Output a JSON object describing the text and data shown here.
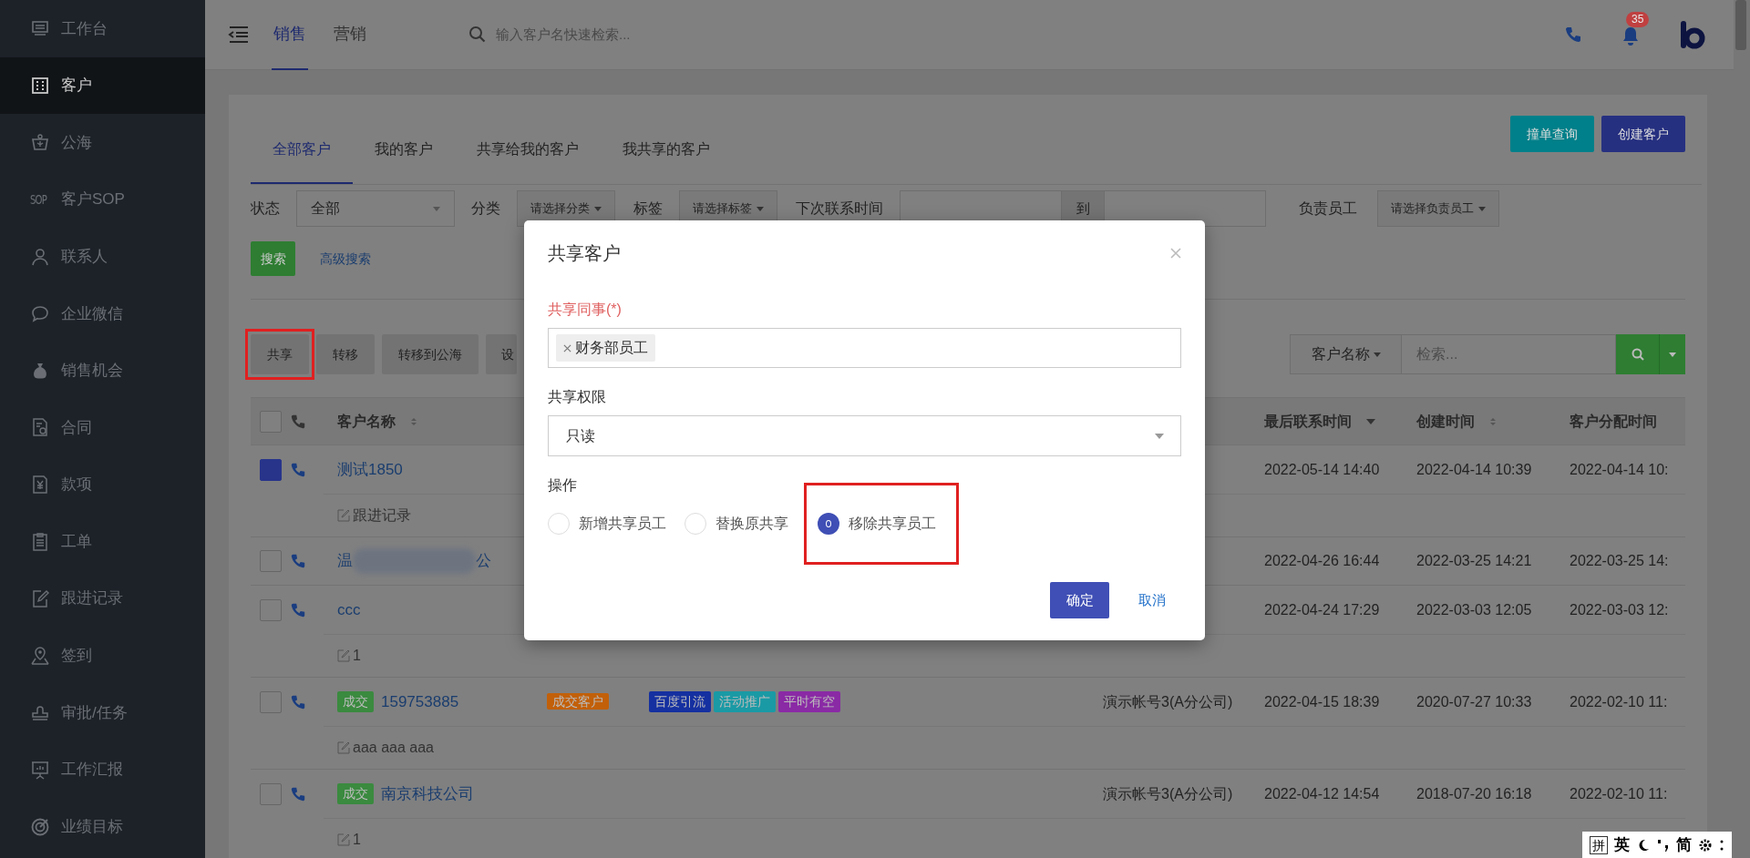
{
  "sidebar": {
    "items": [
      {
        "label": "工作台",
        "selected": false
      },
      {
        "label": "客户",
        "selected": true
      },
      {
        "label": "公海",
        "selected": false
      },
      {
        "label": "客户SOP",
        "icon_text": "SOP",
        "selected": false
      },
      {
        "label": "联系人",
        "selected": false
      },
      {
        "label": "企业微信",
        "selected": false
      },
      {
        "label": "销售机会",
        "selected": false
      },
      {
        "label": "合同",
        "selected": false
      },
      {
        "label": "款项",
        "selected": false
      },
      {
        "label": "工单",
        "selected": false
      },
      {
        "label": "跟进记录",
        "selected": false
      },
      {
        "label": "签到",
        "selected": false
      },
      {
        "label": "审批/任务",
        "selected": false
      },
      {
        "label": "工作汇报",
        "selected": false
      },
      {
        "label": "业绩目标",
        "selected": false
      }
    ]
  },
  "header": {
    "tabs": [
      {
        "label": "销售",
        "selected": true
      },
      {
        "label": "营销",
        "selected": false
      }
    ],
    "search": {
      "placeholder": "输入客户名快速检索..."
    },
    "notification_count": "35"
  },
  "customer_tabs": [
    {
      "label": "全部客户",
      "selected": true
    },
    {
      "label": "我的客户",
      "selected": false
    },
    {
      "label": "共享给我的客户",
      "selected": false
    },
    {
      "label": "我共享的客户",
      "selected": false
    }
  ],
  "top_buttons": [
    {
      "label": "撞单查询",
      "kind": "info"
    },
    {
      "label": "创建客户",
      "kind": "primary"
    }
  ],
  "filters": [
    {
      "kind": "select",
      "label": "状态",
      "value": "全部"
    },
    {
      "kind": "dropdown",
      "label": "分类",
      "placeholder": "请选择分类"
    },
    {
      "kind": "dropdown",
      "label": "标签",
      "placeholder": "请选择标签"
    },
    {
      "kind": "daterange",
      "label": "下次联系时间",
      "separator": "到"
    },
    {
      "kind": "dropdown",
      "label": "负责员工",
      "placeholder": "请选择负责员工"
    }
  ],
  "search_button": "搜索",
  "advanced_search": "高级搜索",
  "actions": [
    {
      "label": "共享",
      "highlighted": true
    },
    {
      "label": "转移",
      "highlighted": false
    },
    {
      "label": "转移到公海",
      "highlighted": false
    },
    {
      "label": "设",
      "highlighted": false
    }
  ],
  "quick_search": {
    "field": "客户名称",
    "placeholder": "检索..."
  },
  "table": {
    "all_checked": false,
    "columns": [
      {
        "label": "客户名称",
        "sortable": true,
        "sorted_desc": false
      },
      {
        "label": "最后联系时间",
        "sortable": true,
        "sorted_desc": true
      },
      {
        "label": "创建时间",
        "sortable": true,
        "sorted_desc": false
      },
      {
        "label": "客户分配时间"
      }
    ],
    "rows": [
      {
        "checked": true,
        "name": "测试1850",
        "last_contact": "2022-05-14 14:40",
        "created": "2022-04-14 10:39",
        "assigned": "2022-04-14 10:",
        "note": "跟进记录"
      },
      {
        "checked": false,
        "name": "温",
        "name_tail": "公",
        "redacted": true,
        "last_contact": "2022-04-26 16:44",
        "created": "2022-03-25 14:21",
        "assigned": "2022-03-25 14:"
      },
      {
        "checked": false,
        "name": "ccc",
        "last_contact": "2022-04-24 17:29",
        "created": "2022-03-03 12:05",
        "assigned": "2022-03-03 12:",
        "note": "1"
      },
      {
        "checked": false,
        "badge": {
          "label": "成交",
          "color": "#3a8a3f"
        },
        "name": "159753885",
        "category": {
          "label": "成交客户",
          "color": "#c2600a"
        },
        "tags": [
          {
            "label": "百度引流",
            "color": "#1530a0"
          },
          {
            "label": "活动推广",
            "color": "#1a9aa5"
          },
          {
            "label": "平时有空",
            "color": "#8a2aa5"
          }
        ],
        "owner": "演示帐号3(A分公司)",
        "last_contact": "2022-04-15 18:39",
        "created": "2020-07-27 10:33",
        "assigned": "2022-02-10 11:",
        "note": "aaa aaa aaa"
      },
      {
        "checked": false,
        "badge": {
          "label": "成交",
          "color": "#3a8a3f"
        },
        "name": "南京科技公司",
        "owner": "演示帐号3(A分公司)",
        "last_contact": "2022-04-12 14:54",
        "created": "2018-07-20 16:18",
        "assigned": "2022-02-10 11:",
        "note": "1"
      }
    ]
  },
  "modal": {
    "title": "共享客户",
    "colleagues": {
      "label": "共享同事(*)",
      "required": true,
      "tags": [
        "财务部员工"
      ]
    },
    "permission": {
      "label": "共享权限",
      "value": "只读"
    },
    "operation": {
      "label": "操作",
      "options": [
        {
          "label": "新增共享员工",
          "selected": false,
          "highlighted": false
        },
        {
          "label": "替换原共享",
          "selected": false,
          "highlighted": false
        },
        {
          "label": "移除共享员工",
          "selected": true,
          "highlighted": true
        }
      ]
    },
    "buttons": [
      {
        "label": "确定",
        "kind": "primary"
      },
      {
        "label": "取消",
        "kind": "link"
      }
    ]
  },
  "ime_bar": {
    "mode": "拼",
    "language": "英",
    "script": "简"
  }
}
